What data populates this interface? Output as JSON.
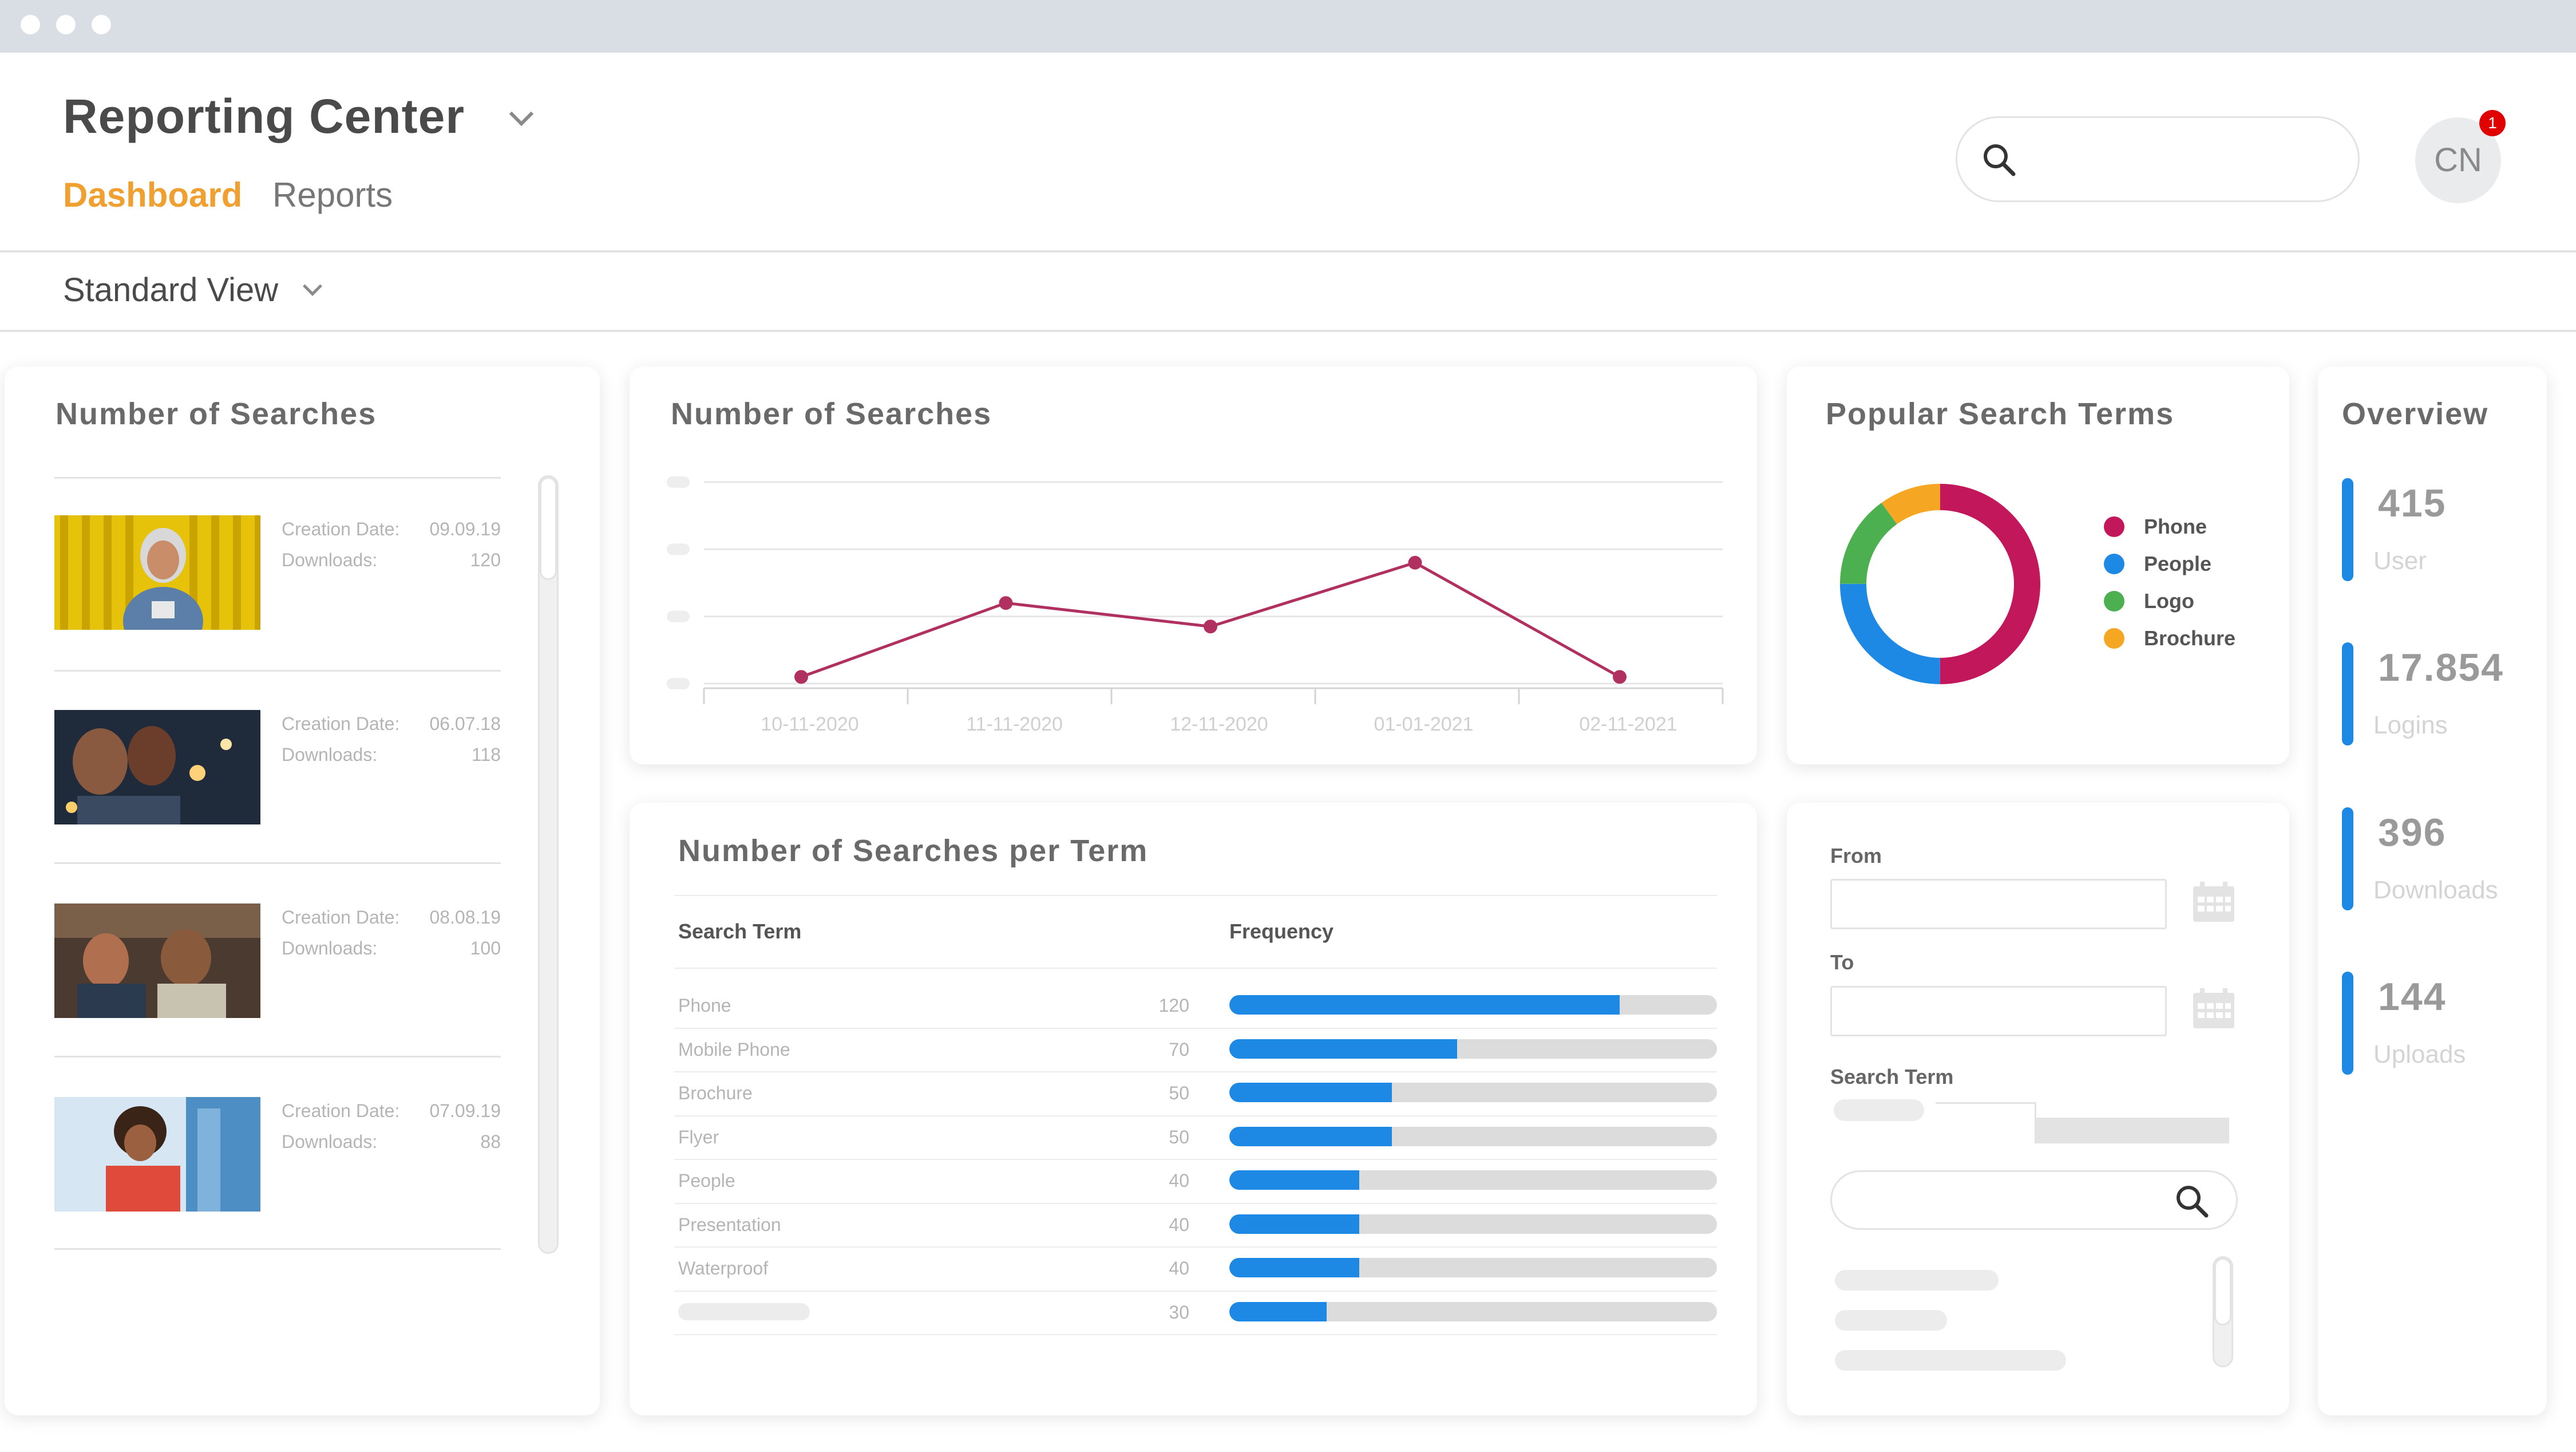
{
  "app": {
    "title": "Reporting Center",
    "tabs": [
      {
        "label": "Dashboard",
        "active": true
      },
      {
        "label": "Reports",
        "active": false
      }
    ],
    "view_label": "Standard View",
    "user_initials": "CN",
    "notification_count": "1",
    "accent_color": "#f0a030",
    "bar_color": "#1e88e5"
  },
  "searches_list": {
    "title": "Number of Searches",
    "creation_label": "Creation Date:",
    "downloads_label": "Downloads:",
    "items": [
      {
        "date": "09.09.19",
        "downloads": "120"
      },
      {
        "date": "06.07.18",
        "downloads": "118"
      },
      {
        "date": "08.08.19",
        "downloads": "100"
      },
      {
        "date": "07.09.19",
        "downloads": "88"
      }
    ]
  },
  "line_chart": {
    "title": "Number of Searches"
  },
  "popular_terms": {
    "title": "Popular Search Terms"
  },
  "overview": {
    "title": "Overview",
    "stats": [
      {
        "value": "415",
        "label": "User"
      },
      {
        "value": "17.854",
        "label": "Logins"
      },
      {
        "value": "396",
        "label": "Downloads"
      },
      {
        "value": "144",
        "label": "Uploads"
      }
    ]
  },
  "terms_table": {
    "title": "Number of Searches per Term",
    "col_term": "Search Term",
    "col_freq": "Frequency"
  },
  "filter": {
    "from_label": "From",
    "to_label": "To",
    "term_label": "Search Term"
  },
  "chart_data": [
    {
      "type": "line",
      "title": "Number of Searches",
      "x": [
        "10-11-2020",
        "11-11-2020",
        "12-11-2020",
        "01-01-2021",
        "02-11-2021"
      ],
      "y": [
        0.1,
        1.2,
        0.85,
        1.8,
        0.1
      ],
      "ylim": [
        0,
        3
      ],
      "grid": true,
      "color": "#b03060"
    },
    {
      "type": "pie",
      "title": "Popular Search Terms",
      "categories": [
        "Phone",
        "People",
        "Logo",
        "Brochure"
      ],
      "values": [
        50,
        25,
        15,
        10
      ],
      "colors": [
        "#c2185b",
        "#1e88e5",
        "#4caf50",
        "#f5a623"
      ],
      "legend": "right"
    },
    {
      "type": "bar",
      "title": "Number of Searches per Term",
      "categories": [
        "Phone",
        "Mobile Phone",
        "Brochure",
        "Flyer",
        "People",
        "Presentation",
        "Waterproof",
        ""
      ],
      "values": [
        120,
        70,
        50,
        50,
        40,
        40,
        40,
        30
      ],
      "xlim": [
        0,
        150
      ]
    }
  ]
}
